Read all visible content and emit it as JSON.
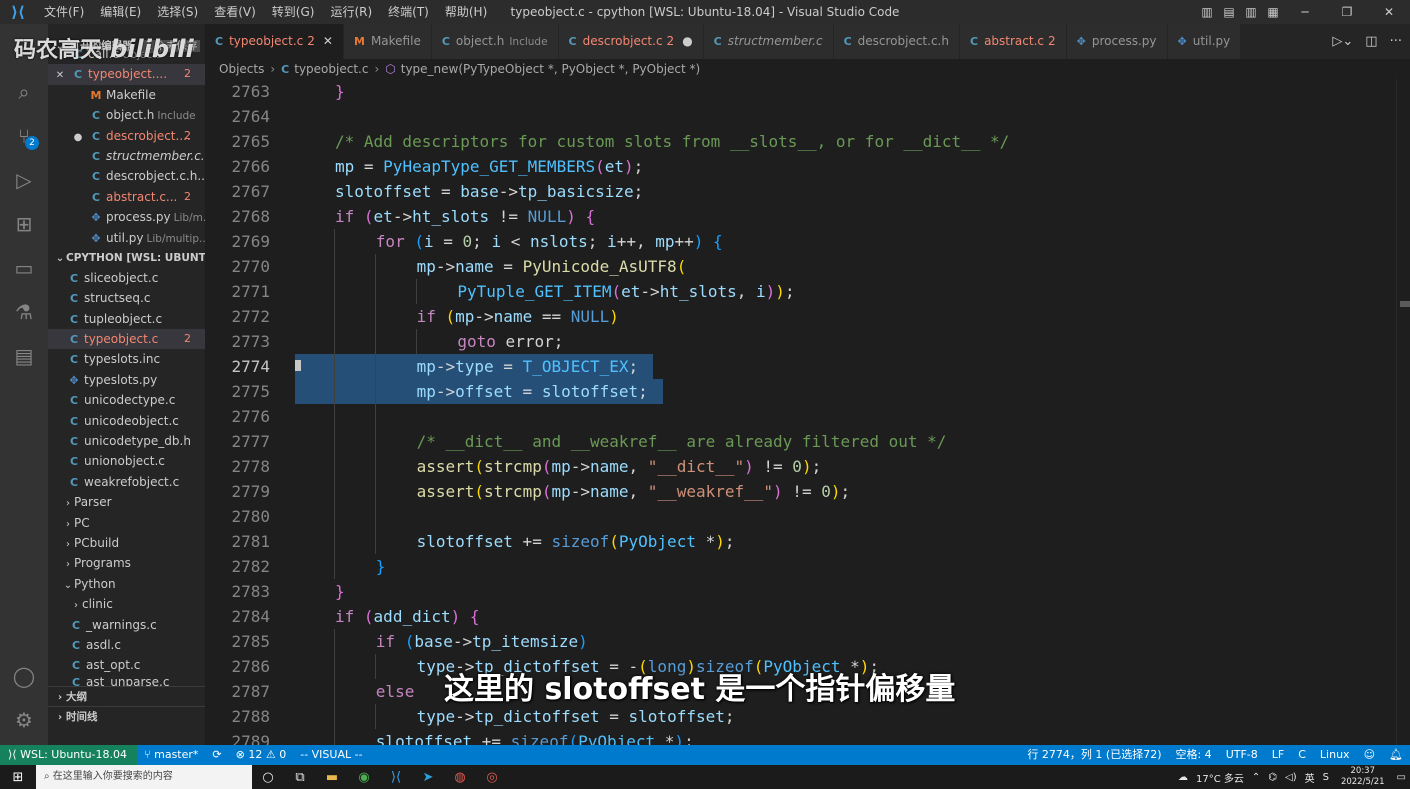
{
  "titlebar": {
    "menus": [
      "文件(F)",
      "编辑(E)",
      "选择(S)",
      "查看(V)",
      "转到(G)",
      "运行(R)",
      "终端(T)",
      "帮助(H)"
    ],
    "title": "typeobject.c - cpython [WSL: Ubuntu-18.04] - Visual Studio Code"
  },
  "watermark": {
    "text": "码农高天",
    "brand": "bilibili"
  },
  "activity_badge": "2",
  "sidebar": {
    "open_editors_label": "打开的编辑器",
    "unsaved_label": "1 个未保存",
    "open_editors": [
      {
        "name": "call.c",
        "dir": "Objects",
        "icon": "C"
      },
      {
        "name": "typeobject....",
        "count": "2",
        "icon": "C",
        "close": "✕",
        "selected": true
      },
      {
        "name": "Makefile",
        "icon": "M"
      },
      {
        "name": "object.h",
        "dir": "Include",
        "icon": "C"
      },
      {
        "name": "descrobject....",
        "count": "2",
        "icon": "C",
        "dot": "●"
      },
      {
        "name": "structmember.c...",
        "icon": "C"
      },
      {
        "name": "descrobject.c.h...",
        "icon": "C"
      },
      {
        "name": "abstract.c...",
        "count": "2",
        "icon": "C"
      },
      {
        "name": "process.py",
        "dir": "Lib/m...",
        "icon": "py"
      },
      {
        "name": "util.py",
        "dir": "Lib/multip...",
        "icon": "py"
      }
    ],
    "workspace_label": "CPYTHON [WSL: UBUNTU-...",
    "files": [
      {
        "name": "sliceobject.c",
        "icon": "C"
      },
      {
        "name": "structseq.c",
        "icon": "C"
      },
      {
        "name": "tupleobject.c",
        "icon": "C"
      },
      {
        "name": "typeobject.c",
        "icon": "C",
        "count": "2",
        "selected": true
      },
      {
        "name": "typeslots.inc",
        "icon": "C"
      },
      {
        "name": "typeslots.py",
        "icon": "py"
      },
      {
        "name": "unicodectype.c",
        "icon": "C"
      },
      {
        "name": "unicodeobject.c",
        "icon": "C"
      },
      {
        "name": "unicodetype_db.h",
        "icon": "C"
      },
      {
        "name": "unionobject.c",
        "icon": "C"
      },
      {
        "name": "weakrefobject.c",
        "icon": "C"
      }
    ],
    "folders": [
      "Parser",
      "PC",
      "PCbuild",
      "Programs"
    ],
    "python_folder": "Python",
    "python_children": [
      {
        "name": "clinic",
        "folder": true
      },
      {
        "name": "_warnings.c",
        "icon": "C"
      },
      {
        "name": "asdl.c",
        "icon": "C"
      },
      {
        "name": "ast_opt.c",
        "icon": "C"
      },
      {
        "name": "ast_unparse.c",
        "icon": "C"
      }
    ],
    "outline_label": "大纲",
    "timeline_label": "时间线"
  },
  "tabs": [
    {
      "name": "typeobject.c",
      "icon": "C",
      "badge": "2",
      "close": "✕",
      "active": true
    },
    {
      "name": "Makefile",
      "icon": "M"
    },
    {
      "name": "object.h",
      "icon": "C",
      "dir": "Include"
    },
    {
      "name": "descrobject.c",
      "icon": "C",
      "badge": "2",
      "dot": "●"
    },
    {
      "name": "structmember.c",
      "icon": "C"
    },
    {
      "name": "descrobject.c.h",
      "icon": "C"
    },
    {
      "name": "abstract.c",
      "icon": "C",
      "badge": "2"
    },
    {
      "name": "process.py",
      "icon": "py"
    },
    {
      "name": "util.py",
      "icon": "py"
    }
  ],
  "breadcrumb": [
    "Objects",
    "typeobject.c",
    "type_new(PyTypeObject *, PyObject *, PyObject *)"
  ],
  "editor": {
    "current_line": 2774,
    "lines": [
      {
        "n": 2763,
        "ind": 1,
        "code": [
          [
            "}",
            "b2"
          ]
        ]
      },
      {
        "n": 2764,
        "ind": 0,
        "code": []
      },
      {
        "n": 2765,
        "ind": 1,
        "code": [
          [
            "/* Add descriptors for custom slots from __slots__, or for __dict__ */",
            "cm"
          ]
        ]
      },
      {
        "n": 2766,
        "ind": 1,
        "code": [
          [
            "mp",
            "vr"
          ],
          [
            " = ",
            ""
          ],
          [
            "PyHeapType_GET_MEMBERS",
            "mc"
          ],
          [
            "(",
            "b2"
          ],
          [
            "et",
            "vr"
          ],
          [
            ")",
            "b2"
          ],
          [
            ";",
            ""
          ]
        ]
      },
      {
        "n": 2767,
        "ind": 1,
        "code": [
          [
            "slotoffset",
            "vr"
          ],
          [
            " = ",
            ""
          ],
          [
            "base",
            "vr"
          ],
          [
            "->",
            ""
          ],
          [
            "tp_basicsize",
            "vr"
          ],
          [
            ";",
            ""
          ]
        ]
      },
      {
        "n": 2768,
        "ind": 1,
        "code": [
          [
            "if",
            "kw"
          ],
          [
            " ",
            ""
          ],
          [
            "(",
            "b2"
          ],
          [
            "et",
            "vr"
          ],
          [
            "->",
            ""
          ],
          [
            "ht_slots",
            "vr"
          ],
          [
            " != ",
            ""
          ],
          [
            "NULL",
            "ty"
          ],
          [
            ")",
            "b2"
          ],
          [
            " ",
            ""
          ],
          [
            "{",
            "b2"
          ]
        ]
      },
      {
        "n": 2769,
        "ind": 2,
        "code": [
          [
            "for",
            "kw"
          ],
          [
            " ",
            ""
          ],
          [
            "(",
            "b3"
          ],
          [
            "i",
            "vr"
          ],
          [
            " = ",
            ""
          ],
          [
            "0",
            "nm"
          ],
          [
            "; ",
            ""
          ],
          [
            "i",
            "vr"
          ],
          [
            " < ",
            ""
          ],
          [
            "nslots",
            "vr"
          ],
          [
            "; ",
            ""
          ],
          [
            "i",
            "vr"
          ],
          [
            "++, ",
            ""
          ],
          [
            "mp",
            "vr"
          ],
          [
            "++",
            ""
          ],
          [
            ")",
            "b3"
          ],
          [
            " ",
            ""
          ],
          [
            "{",
            "b3"
          ]
        ]
      },
      {
        "n": 2770,
        "ind": 3,
        "code": [
          [
            "mp",
            "vr"
          ],
          [
            "->",
            ""
          ],
          [
            "name",
            "vr"
          ],
          [
            " = ",
            ""
          ],
          [
            "PyUnicode_AsUTF8",
            "fn"
          ],
          [
            "(",
            "b1"
          ]
        ]
      },
      {
        "n": 2771,
        "ind": 4,
        "code": [
          [
            "PyTuple_GET_ITEM",
            "mc"
          ],
          [
            "(",
            "b2"
          ],
          [
            "et",
            "vr"
          ],
          [
            "->",
            ""
          ],
          [
            "ht_slots",
            "vr"
          ],
          [
            ", ",
            ""
          ],
          [
            "i",
            "vr"
          ],
          [
            ")",
            "b2"
          ],
          [
            ")",
            "b1"
          ],
          [
            ";",
            ""
          ]
        ]
      },
      {
        "n": 2772,
        "ind": 3,
        "code": [
          [
            "if",
            "kw"
          ],
          [
            " ",
            ""
          ],
          [
            "(",
            "b1"
          ],
          [
            "mp",
            "vr"
          ],
          [
            "->",
            ""
          ],
          [
            "name",
            "vr"
          ],
          [
            " == ",
            ""
          ],
          [
            "NULL",
            "ty"
          ],
          [
            ")",
            "b1"
          ]
        ]
      },
      {
        "n": 2773,
        "ind": 4,
        "code": [
          [
            "goto",
            "kw"
          ],
          [
            " error;",
            ""
          ]
        ]
      },
      {
        "n": 2774,
        "ind": 3,
        "sel": true,
        "code": [
          [
            "mp",
            "vr"
          ],
          [
            "->",
            ""
          ],
          [
            "type",
            "vr"
          ],
          [
            " = ",
            ""
          ],
          [
            "T_OBJECT_EX",
            "mc"
          ],
          [
            ";",
            ""
          ]
        ]
      },
      {
        "n": 2775,
        "ind": 3,
        "sel": true,
        "code": [
          [
            "mp",
            "vr"
          ],
          [
            "->",
            ""
          ],
          [
            "offset",
            "vr"
          ],
          [
            " = ",
            ""
          ],
          [
            "slotoffset",
            "vr"
          ],
          [
            ";",
            ""
          ]
        ]
      },
      {
        "n": 2776,
        "ind": 0,
        "code": []
      },
      {
        "n": 2777,
        "ind": 3,
        "code": [
          [
            "/* __dict__ and __weakref__ are already filtered out */",
            "cm"
          ]
        ]
      },
      {
        "n": 2778,
        "ind": 3,
        "code": [
          [
            "assert",
            "fn"
          ],
          [
            "(",
            "b1"
          ],
          [
            "strcmp",
            "fn"
          ],
          [
            "(",
            "b2"
          ],
          [
            "mp",
            "vr"
          ],
          [
            "->",
            ""
          ],
          [
            "name",
            "vr"
          ],
          [
            ", ",
            ""
          ],
          [
            "\"__dict__\"",
            "st"
          ],
          [
            ")",
            "b2"
          ],
          [
            " != ",
            ""
          ],
          [
            "0",
            "nm"
          ],
          [
            ")",
            "b1"
          ],
          [
            ";",
            ""
          ]
        ]
      },
      {
        "n": 2779,
        "ind": 3,
        "code": [
          [
            "assert",
            "fn"
          ],
          [
            "(",
            "b1"
          ],
          [
            "strcmp",
            "fn"
          ],
          [
            "(",
            "b2"
          ],
          [
            "mp",
            "vr"
          ],
          [
            "->",
            ""
          ],
          [
            "name",
            "vr"
          ],
          [
            ", ",
            ""
          ],
          [
            "\"__weakref__\"",
            "st"
          ],
          [
            ")",
            "b2"
          ],
          [
            " != ",
            ""
          ],
          [
            "0",
            "nm"
          ],
          [
            ")",
            "b1"
          ],
          [
            ";",
            ""
          ]
        ]
      },
      {
        "n": 2780,
        "ind": 0,
        "code": []
      },
      {
        "n": 2781,
        "ind": 3,
        "code": [
          [
            "slotoffset",
            "vr"
          ],
          [
            " += ",
            ""
          ],
          [
            "sizeof",
            "ty"
          ],
          [
            "(",
            "b1"
          ],
          [
            "PyObject",
            "mc"
          ],
          [
            " *",
            ""
          ],
          [
            ")",
            "b1"
          ],
          [
            ";",
            ""
          ]
        ]
      },
      {
        "n": 2782,
        "ind": 2,
        "code": [
          [
            "}",
            "b3"
          ]
        ]
      },
      {
        "n": 2783,
        "ind": 1,
        "code": [
          [
            "}",
            "b2"
          ]
        ]
      },
      {
        "n": 2784,
        "ind": 1,
        "code": [
          [
            "if",
            "kw"
          ],
          [
            " ",
            ""
          ],
          [
            "(",
            "b2"
          ],
          [
            "add_dict",
            "vr"
          ],
          [
            ")",
            "b2"
          ],
          [
            " ",
            ""
          ],
          [
            "{",
            "b2"
          ]
        ]
      },
      {
        "n": 2785,
        "ind": 2,
        "code": [
          [
            "if",
            "kw"
          ],
          [
            " ",
            ""
          ],
          [
            "(",
            "b3"
          ],
          [
            "base",
            "vr"
          ],
          [
            "->",
            ""
          ],
          [
            "tp_itemsize",
            "vr"
          ],
          [
            ")",
            "b3"
          ]
        ]
      },
      {
        "n": 2786,
        "ind": 3,
        "code": [
          [
            "type",
            "vr"
          ],
          [
            "->",
            ""
          ],
          [
            "tp_dictoffset",
            "vr"
          ],
          [
            " = -",
            ""
          ],
          [
            "(",
            "b1"
          ],
          [
            "long",
            "ty"
          ],
          [
            ")",
            "b1"
          ],
          [
            "sizeof",
            "ty"
          ],
          [
            "(",
            "b1"
          ],
          [
            "PyObject",
            "mc"
          ],
          [
            " *",
            ""
          ],
          [
            ")",
            "b1"
          ],
          [
            ";",
            ""
          ]
        ]
      },
      {
        "n": 2787,
        "ind": 2,
        "code": [
          [
            "else",
            "kw"
          ]
        ]
      },
      {
        "n": 2788,
        "ind": 3,
        "code": [
          [
            "type",
            "vr"
          ],
          [
            "->",
            ""
          ],
          [
            "tp_dictoffset",
            "vr"
          ],
          [
            " = ",
            ""
          ],
          [
            "slotoffset",
            "vr"
          ],
          [
            ";",
            ""
          ]
        ]
      },
      {
        "n": 2789,
        "ind": 2,
        "code": [
          [
            "slotoffset",
            "vr"
          ],
          [
            " += ",
            ""
          ],
          [
            "sizeof",
            "ty"
          ],
          [
            "(",
            "b3"
          ],
          [
            "PyObject",
            "mc"
          ],
          [
            " *",
            ""
          ],
          [
            ")",
            "b3"
          ],
          [
            ";",
            ""
          ]
        ]
      }
    ]
  },
  "subtitle": "这里的 slotoffset 是一个指针偏移量",
  "status": {
    "remote": "WSL: Ubuntu-18.04",
    "branch": "master*",
    "sync": "⟳",
    "errors": "12",
    "warnings": "0",
    "mode": "-- VISUAL --",
    "position": "行 2774，列 1 (已选择72)",
    "spaces": "空格: 4",
    "encoding": "UTF-8",
    "eol": "LF",
    "language": "C",
    "os": "Linux"
  },
  "taskbar": {
    "search_placeholder": "在这里输入你要搜索的内容",
    "weather": "17°C 多云",
    "ime": "英",
    "time": "20:37",
    "date": "2022/5/21"
  },
  "colors": {
    "accent": "#007acc",
    "remote": "#16825d",
    "selection": "#264f78"
  }
}
